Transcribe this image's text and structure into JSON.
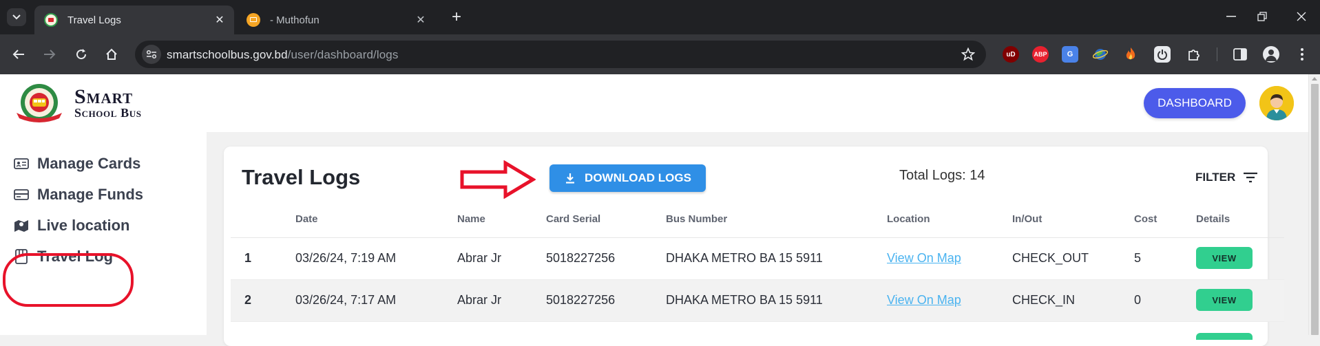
{
  "browser": {
    "tabs": [
      {
        "title": "Travel Logs",
        "active": true
      },
      {
        "title": "- Muthofun",
        "active": false
      }
    ],
    "url_host": "smartschoolbus.gov.bd",
    "url_path": "/user/dashboard/logs",
    "extensions": [
      "ublock-icon",
      "abp-icon",
      "translate-icon",
      "earth-icon",
      "fire-icon",
      "power-icon",
      "puzzle-icon"
    ],
    "ext_labels": {
      "ublock": "uD",
      "abp": "ABP"
    }
  },
  "header": {
    "brand_line1": "Smart",
    "brand_line2": "School Bus",
    "dashboard_label": "DASHBOARD"
  },
  "sidebar": {
    "items": [
      {
        "label": "Manage Cards",
        "icon": "id-card-icon"
      },
      {
        "label": "Manage Funds",
        "icon": "card-icon"
      },
      {
        "label": "Live location",
        "icon": "map-icon"
      },
      {
        "label": "Travel Log",
        "icon": "book-icon"
      }
    ]
  },
  "main": {
    "title": "Travel Logs",
    "download_label": "DOWNLOAD LOGS",
    "total_label": "Total Logs: 14",
    "filter_label": "FILTER",
    "columns": [
      "Date",
      "Name",
      "Card Serial",
      "Bus Number",
      "Location",
      "In/Out",
      "Cost",
      "Details"
    ],
    "rows": [
      {
        "index": "1",
        "date": "03/26/24, 7:19 AM",
        "name": "Abrar Jr",
        "card_serial": "5018227256",
        "bus_number": "DHAKA METRO BA 15 5911",
        "location": "View On Map",
        "in_out": "CHECK_OUT",
        "cost": "5",
        "details": "VIEW"
      },
      {
        "index": "2",
        "date": "03/26/24, 7:17 AM",
        "name": "Abrar Jr",
        "card_serial": "5018227256",
        "bus_number": "DHAKA METRO BA 15 5911",
        "location": "View On Map",
        "in_out": "CHECK_IN",
        "cost": "0",
        "details": "VIEW"
      }
    ]
  },
  "colors": {
    "dashboard_btn": "#4c5bea",
    "download_btn": "#2f8fe6",
    "view_btn": "#31cf8f",
    "annotation_red": "#e8122a",
    "link": "#4ab3f0"
  }
}
